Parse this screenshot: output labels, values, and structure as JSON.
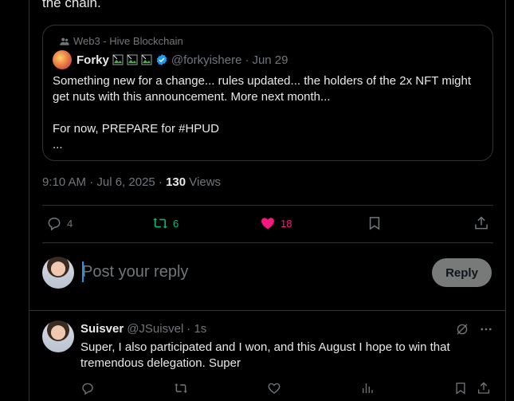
{
  "tail_text": "the chain.",
  "quote": {
    "context": "Web3 - Hive Blockchain",
    "name": "Forky",
    "handle": "@forkyishere",
    "date": "Jun 29",
    "body": "Something new for a change... rules updated... the holders of the 2x NFT might get nuts with this announcement. More next month...\n\nFor now, PREPARE for #HPUD\n..."
  },
  "meta": {
    "time": "9:10 AM · Jul 6, 2025 · ",
    "views_count": "130",
    "views_label": " Views"
  },
  "actions": {
    "replies": "4",
    "reposts": "6",
    "likes": "18"
  },
  "reply_box": {
    "placeholder": "Post your reply",
    "button": "Reply"
  },
  "comment": {
    "name": "Suisver",
    "handle": "@JSuisvel",
    "time": "· 1s",
    "body": "Super, I also participated and I won, and this August I hope to win that tremendous delegation. Super"
  },
  "colors": {
    "accent": "#1d9bf0",
    "repost": "#00ba7c",
    "like": "#f91880",
    "muted": "#71767b"
  }
}
